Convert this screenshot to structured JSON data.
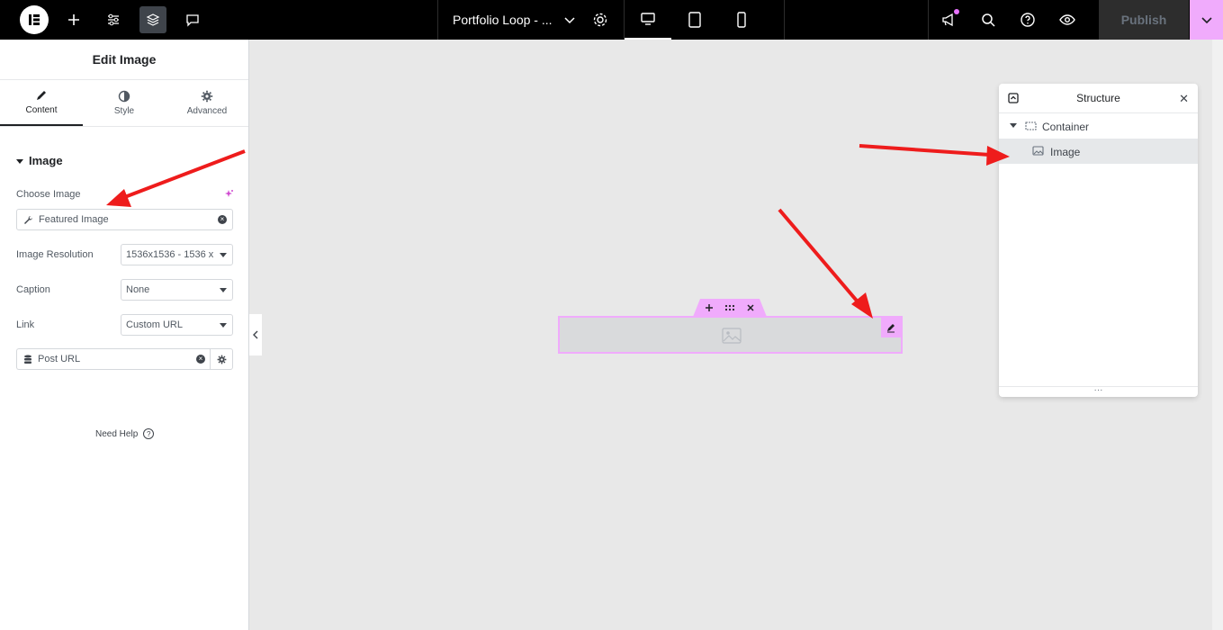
{
  "topbar": {
    "document_title": "Portfolio Loop - ...",
    "publish_label": "Publish"
  },
  "panel": {
    "title": "Edit Image",
    "tabs": [
      {
        "label": "Content"
      },
      {
        "label": "Style"
      },
      {
        "label": "Advanced"
      }
    ],
    "section_title": "Image",
    "choose_image_label": "Choose Image",
    "choose_image_value": "Featured Image",
    "resolution_label": "Image Resolution",
    "resolution_value": "1536x1536 - 1536 x",
    "caption_label": "Caption",
    "caption_value": "None",
    "link_label": "Link",
    "link_value": "Custom URL",
    "link_dynamic_value": "Post URL",
    "need_help": "Need Help"
  },
  "structure": {
    "title": "Structure",
    "items": [
      {
        "label": "Container"
      },
      {
        "label": "Image"
      }
    ]
  },
  "colors": {
    "accent": "#f0abfc",
    "arrow": "#ee1c1c",
    "topbar": "#000000"
  }
}
